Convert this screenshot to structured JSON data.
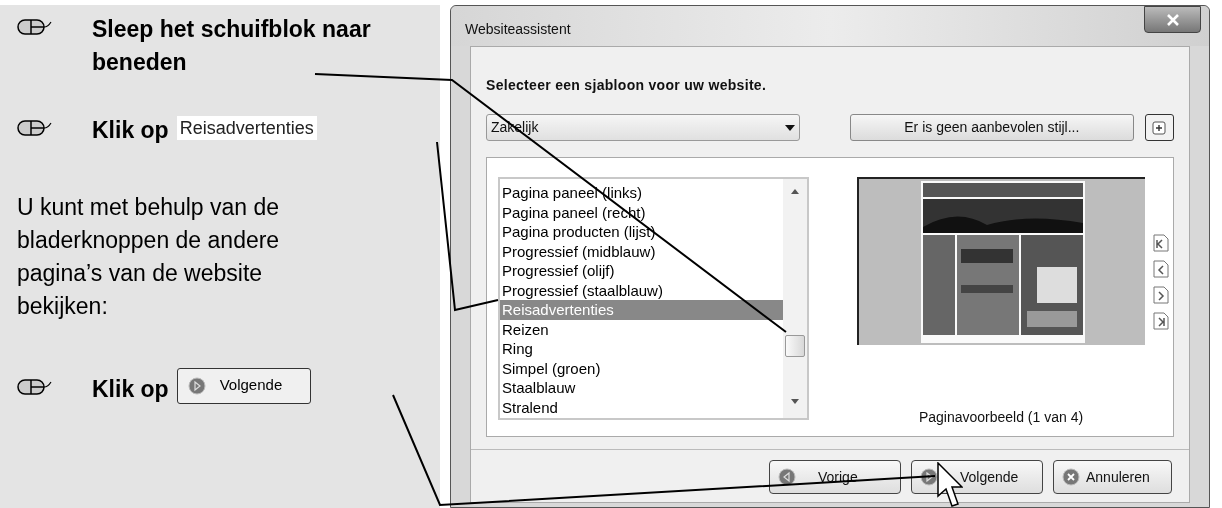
{
  "instructions": [
    {
      "kind": "step",
      "text": "Sleep het schuifblok naar beneden"
    },
    {
      "kind": "step",
      "text": "Klik op",
      "inset": {
        "kind": "list-item",
        "label": "Reisadvertenties"
      }
    },
    {
      "kind": "note",
      "text": "U kunt met behulp van de bladerknoppen de andere pagina’s van de website bekijken:"
    },
    {
      "kind": "step",
      "text": "Klik op",
      "inset": {
        "kind": "button",
        "label": "Volgende"
      }
    }
  ],
  "window": {
    "title": "Websiteassistent",
    "heading": "Selecteer een sjabloon voor uw website.",
    "category": "Zakelijk",
    "style_button": "Er is geen aanbevolen stijl...",
    "templates": [
      {
        "label": "Pagina paneel (links)",
        "selected": false
      },
      {
        "label": "Pagina paneel (recht)",
        "selected": false
      },
      {
        "label": "Pagina producten (lijst)",
        "selected": false
      },
      {
        "label": "Progressief (midblauw)",
        "selected": false
      },
      {
        "label": "Progressief (olijf)",
        "selected": false
      },
      {
        "label": "Progressief (staalblauw)",
        "selected": false
      },
      {
        "label": "Reisadvertenties",
        "selected": true
      },
      {
        "label": "Reizen",
        "selected": false
      },
      {
        "label": "Ring",
        "selected": false
      },
      {
        "label": "Simpel (groen)",
        "selected": false
      },
      {
        "label": "Staalblauw",
        "selected": false
      },
      {
        "label": "Stralend",
        "selected": false
      }
    ],
    "preview_caption": "Paginavoorbeeld (1 van 4)",
    "buttons": [
      {
        "kind": "back",
        "label": "Vorige"
      },
      {
        "kind": "next",
        "label": "Volgende"
      },
      {
        "kind": "cancel",
        "label": "Annuleren"
      }
    ]
  }
}
